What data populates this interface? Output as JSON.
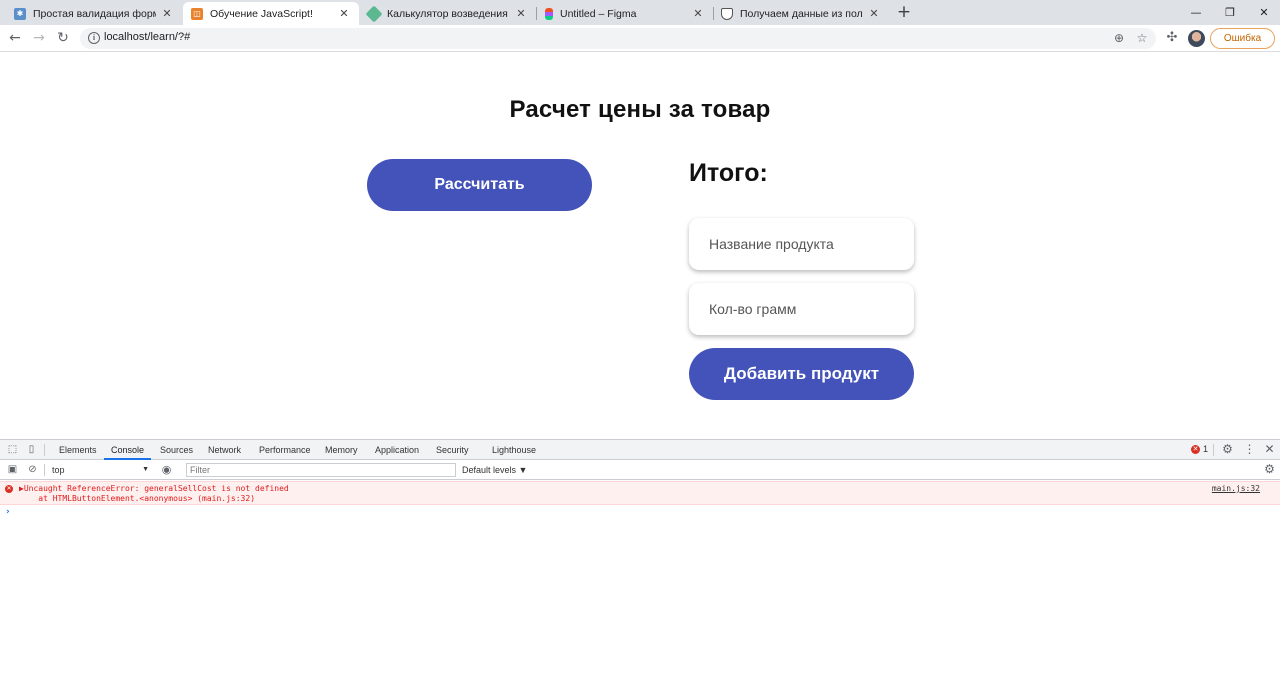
{
  "browser": {
    "tabs": [
      {
        "title": "Простая валидация формы без",
        "active": false
      },
      {
        "title": "Обучение JavaScript!",
        "active": true
      },
      {
        "title": "Калькулятор возведения в степе",
        "active": false
      },
      {
        "title": "Untitled – Figma",
        "active": false
      },
      {
        "title": "Получаем данные из поля ввод",
        "active": false
      }
    ],
    "url": "localhost/learn/?#",
    "error_button": "Ошибка"
  },
  "page": {
    "title": "Расчет цены за товар",
    "calculate_button": "Рассчитать",
    "total_label": "Итого:",
    "product_name_placeholder": "Название продукта",
    "grams_placeholder": "Кол-во грамм",
    "add_product_button": "Добавить продукт",
    "accent_color": "#4453b9"
  },
  "devtools": {
    "tabs": [
      "Elements",
      "Console",
      "Sources",
      "Network",
      "Performance",
      "Memory",
      "Application",
      "Security",
      "Lighthouse"
    ],
    "active_tab": "Console",
    "error_count": "1",
    "context": "top",
    "filter_placeholder": "Filter",
    "levels": "Default levels ▼",
    "error_line1": "▶Uncaught ReferenceError: generalSellCost is not defined",
    "error_line2": "    at HTMLButtonElement.<anonymous> (main.js:32)",
    "error_source": "main.js:32",
    "prompt": "›"
  }
}
